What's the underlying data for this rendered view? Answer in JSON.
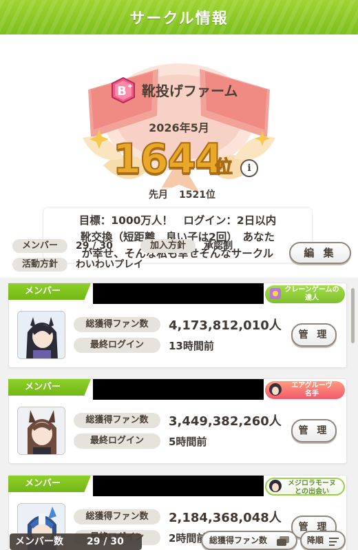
{
  "header": {
    "title": "サークル情報"
  },
  "circle": {
    "rank_badge": "B+",
    "name": "靴投げファーム",
    "date": "2026年5月",
    "rank": "1644",
    "rank_unit": "位",
    "info_icon": "i",
    "last_month_label": "先月",
    "last_month_rank": "1521位",
    "goal": "目標：1000万人！　ログイン：2日以内\n靴交換（短距離　良い子は2回）　あなた\nが幸せ、そんな私も幸せそんなサークル"
  },
  "policy": {
    "members_label": "メンバー",
    "members_value": "29 / 30",
    "join_label": "加入方針",
    "join_value": "承認制",
    "activity_label": "活動方針",
    "activity_value": "わいわいプレイ",
    "edit_button": "編 集"
  },
  "members": [
    {
      "label": "メンバー",
      "title": "クレーンゲームの\n達人",
      "title_color": "#8fcf3a",
      "fans_label": "総獲得ファン数",
      "fans": "4,173,812,010人",
      "login_label": "最終ログイン",
      "login": "13時間前",
      "manage": "管 理"
    },
    {
      "label": "メンバー",
      "title": "エアグルーヴ\n名手",
      "title_color": "#f07a6a",
      "fans_label": "総獲得ファン数",
      "fans": "3,449,382,260人",
      "login_label": "最終ログイン",
      "login": "5時間前",
      "manage": "管 理"
    },
    {
      "label": "メンバー",
      "title": "メジロラモーヌ\nとの出会い",
      "title_color": "#8fcf3a",
      "fans_label": "総獲得ファン数",
      "fans": "2,184,368,048人",
      "login_label": "最終ログイン",
      "login": "2時間前",
      "manage": "管 理"
    }
  ],
  "footer": {
    "member_count_label": "メンバー数",
    "member_count_value": "29 / 30",
    "sort_label": "総獲得ファン数",
    "order_label": "降順"
  },
  "icons": {
    "rank_badge": "rank-b-plus-icon",
    "info": "info-icon",
    "sort_toggle": "sort-card-icon",
    "order": "menu-lines-icon"
  }
}
